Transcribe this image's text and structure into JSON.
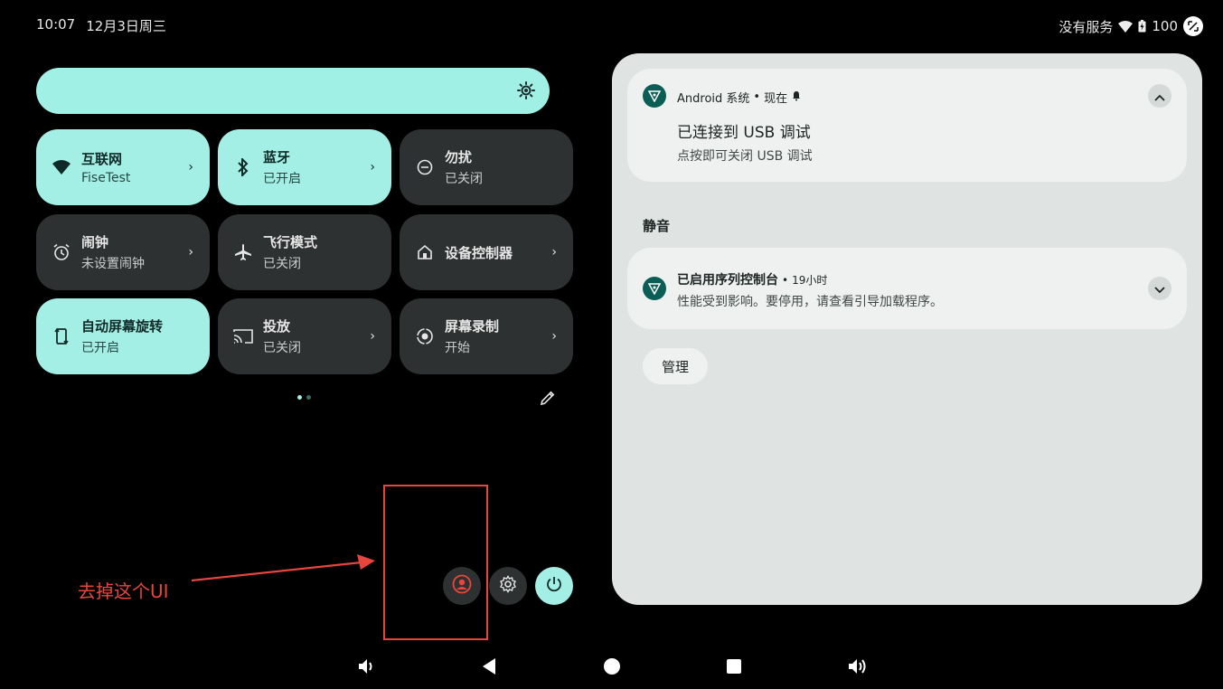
{
  "status": {
    "time": "10:07",
    "date": "12月3日周三",
    "carrier": "没有服务",
    "battery": "100"
  },
  "quick_settings": {
    "tiles": [
      {
        "title": "互联网",
        "subtitle": "FiseTest",
        "state": "on",
        "chevron": true
      },
      {
        "title": "蓝牙",
        "subtitle": "已开启",
        "state": "on",
        "chevron": true
      },
      {
        "title": "勿扰",
        "subtitle": "已关闭",
        "state": "off",
        "chevron": false
      },
      {
        "title": "闹钟",
        "subtitle": "未设置闹钟",
        "state": "off",
        "chevron": true
      },
      {
        "title": "飞行模式",
        "subtitle": "已关闭",
        "state": "off",
        "chevron": false
      },
      {
        "title": "设备控制器",
        "subtitle": "",
        "state": "off",
        "chevron": true
      },
      {
        "title": "自动屏幕旋转",
        "subtitle": "已开启",
        "state": "on",
        "chevron": false
      },
      {
        "title": "投放",
        "subtitle": "已关闭",
        "state": "off",
        "chevron": true
      },
      {
        "title": "屏幕录制",
        "subtitle": "开始",
        "state": "off",
        "chevron": true
      }
    ],
    "chevron_glyph": "›",
    "page_count": 2,
    "current_page": 1
  },
  "annotation": {
    "text": "去掉这个UI",
    "color": "#e8453c"
  },
  "notifications": {
    "usb": {
      "app": "Android 系统",
      "when": "现在",
      "title": "已连接到 USB 调试",
      "body": "点按即可关闭 USB 调试"
    },
    "silent_header": "静音",
    "console": {
      "title": "已启用序列控制台",
      "when": "19小时",
      "body": "性能受到影响。要停用，请查看引导加载程序。"
    },
    "manage_label": "管理"
  },
  "colors": {
    "accent": "#a3efe5",
    "tile_off": "#2e3132",
    "panel": "#dfe3e1",
    "app_icon": "#0b5e55"
  }
}
